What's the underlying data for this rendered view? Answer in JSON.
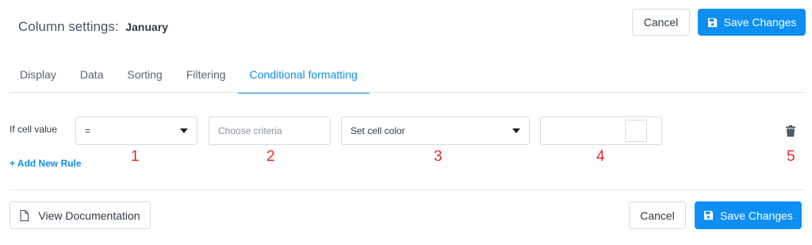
{
  "header": {
    "title_prefix": "Column settings:",
    "column_name": "January",
    "cancel_label": "Cancel",
    "save_label": "Save Changes"
  },
  "tabs": [
    {
      "label": "Display",
      "active": false
    },
    {
      "label": "Data",
      "active": false
    },
    {
      "label": "Sorting",
      "active": false
    },
    {
      "label": "Filtering",
      "active": false
    },
    {
      "label": "Conditional formatting",
      "active": true
    }
  ],
  "rule": {
    "label": "If cell value",
    "operator": "=",
    "criteria_placeholder": "Choose criteria",
    "criteria_value": "",
    "action": "Set cell color",
    "color_value": ""
  },
  "add_rule_label": "+ Add New Rule",
  "annotations": [
    "1",
    "2",
    "3",
    "4",
    "5"
  ],
  "footer": {
    "doc_label": "View Documentation",
    "cancel_label": "Cancel",
    "save_label": "Save Changes"
  },
  "colors": {
    "accent": "#0d8ef2",
    "annotation": "#e8272b",
    "border": "#d6dbe0"
  },
  "icons": [
    "floppy-disk-icon",
    "file-icon",
    "trash-icon",
    "caret-down-icon"
  ]
}
